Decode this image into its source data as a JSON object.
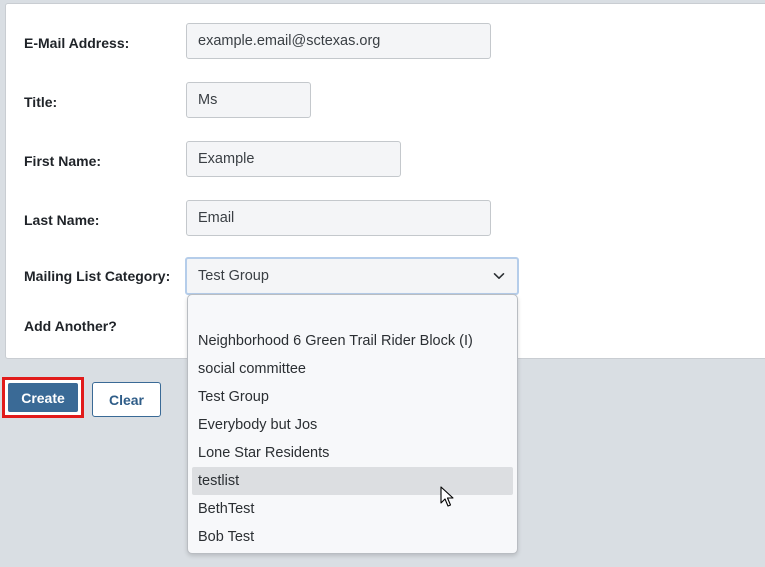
{
  "form": {
    "email": {
      "label": "E-Mail Address:",
      "value": "example.email@sctexas.org"
    },
    "title": {
      "label": "Title:",
      "value": "Ms"
    },
    "first_name": {
      "label": "First Name:",
      "value": "Example"
    },
    "last_name": {
      "label": "Last Name:",
      "value": "Email"
    },
    "mailing_list": {
      "label": "Mailing List Category:",
      "value": "Test Group"
    },
    "add_another": {
      "label": "Add Another?"
    }
  },
  "buttons": {
    "create": "Create",
    "clear": "Clear"
  },
  "dropdown": {
    "options": [
      "",
      "Neighborhood 6 Green Trail Rider Block (I)",
      "social committee",
      "Test Group",
      "Everybody but Jos",
      "Lone Star Residents",
      "testlist",
      "BethTest",
      "Bob Test"
    ],
    "highlighted": "testlist"
  },
  "colors": {
    "primary": "#3a6a96",
    "highlight_border": "#e11b1b",
    "background": "#d9dee3"
  }
}
